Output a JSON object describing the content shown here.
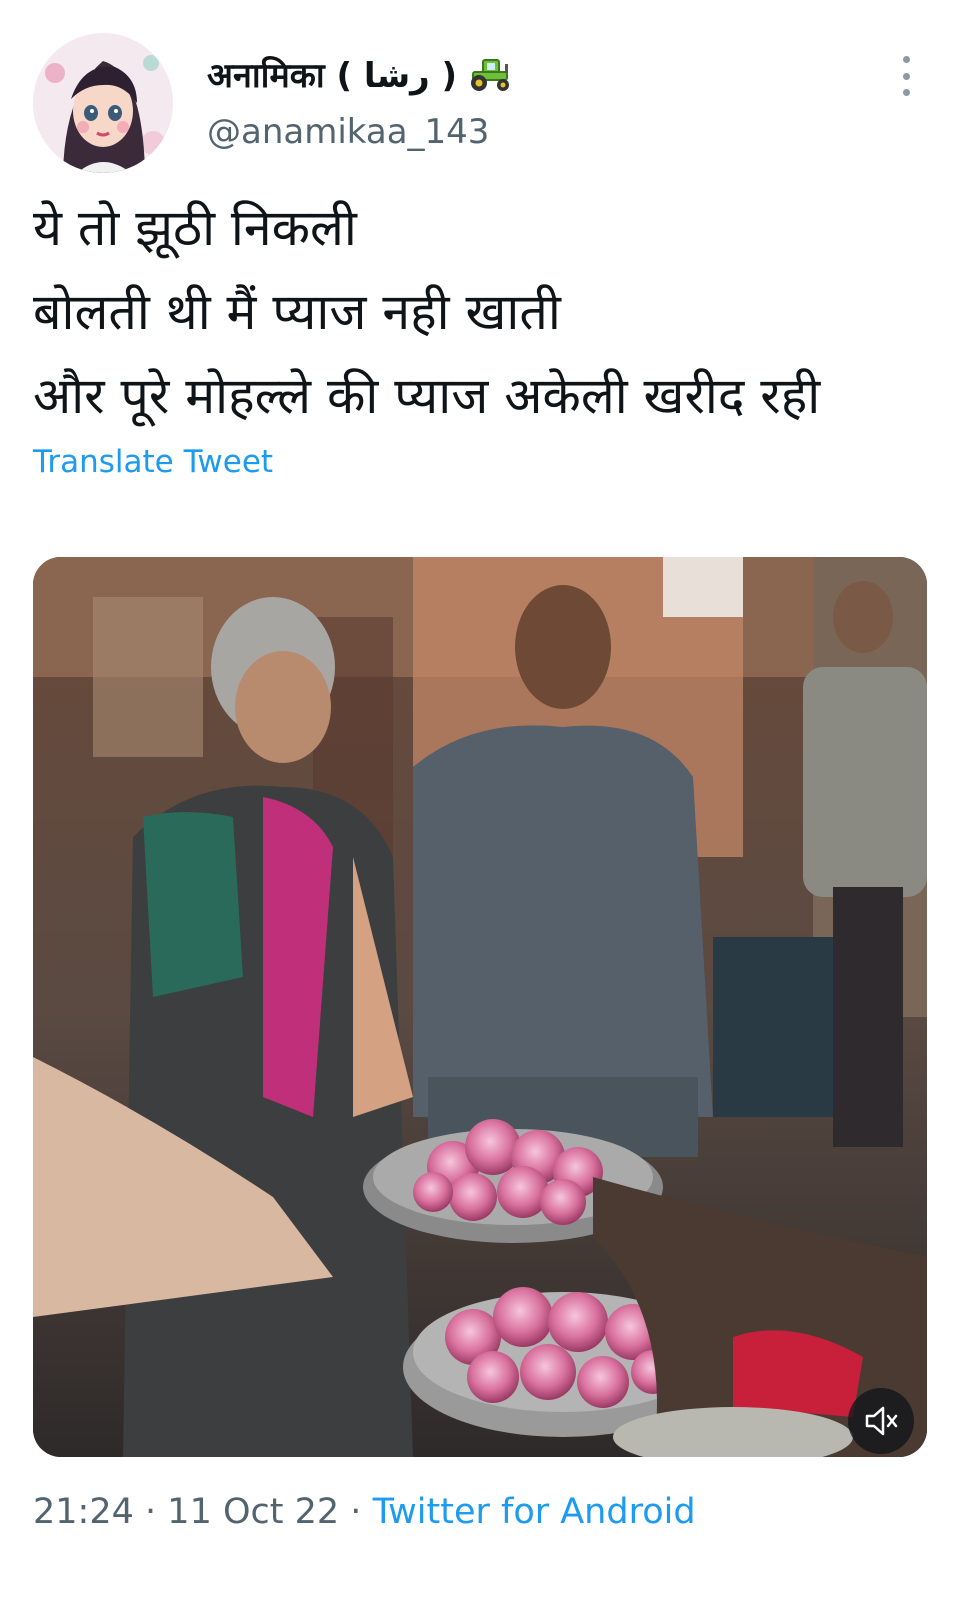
{
  "author": {
    "display_name": "अनामिका ( رشا )",
    "badge_icon": "tractor-icon",
    "handle": "@anamikaa_143",
    "avatar_icon": "cartoon-girl-avatar"
  },
  "tweet": {
    "lines": [
      "ये तो झूठी निकली",
      "बोलती थी मैं प्याज नही खाती",
      "और पूरे मोहल्ले की प्याज अकेली खरीद रही"
    ],
    "translate_label": "Translate Tweet"
  },
  "media": {
    "type": "video",
    "mute_icon": "speaker-muted-icon"
  },
  "meta": {
    "time": "21:24",
    "date": "11 Oct 22",
    "separator": "·",
    "source": "Twitter for Android"
  },
  "colors": {
    "link": "#1d9bf0",
    "secondary_text": "#536471",
    "primary_text": "#0f1419"
  }
}
